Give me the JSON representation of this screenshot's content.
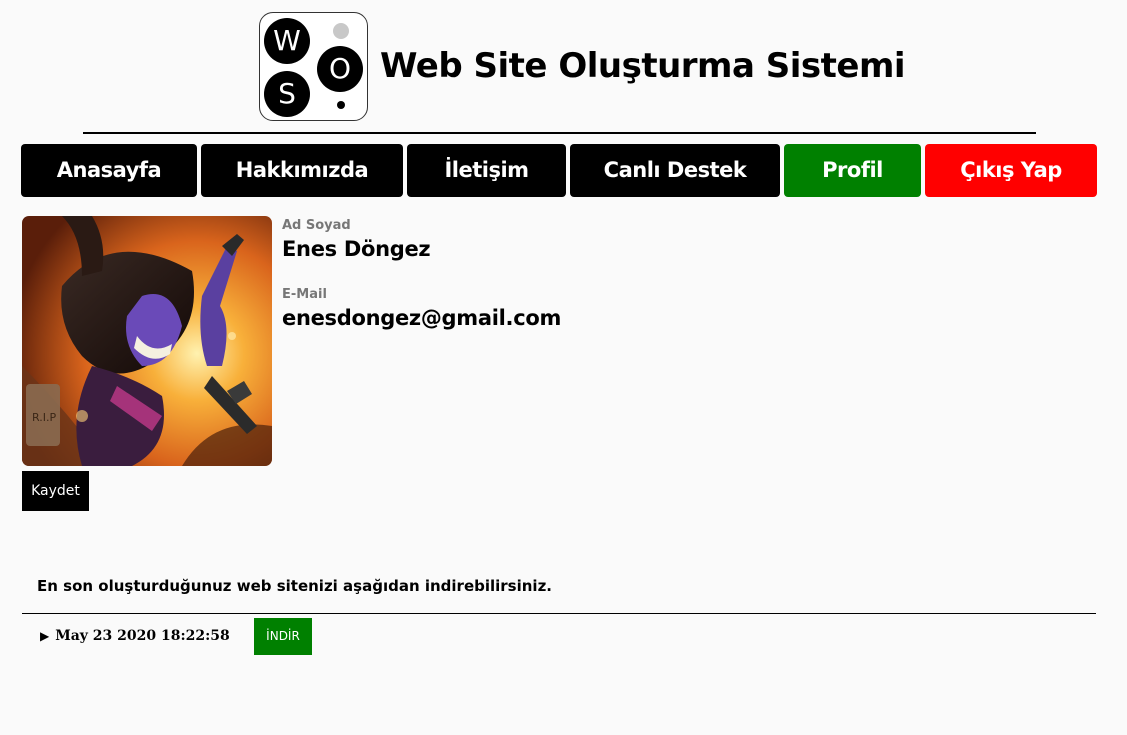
{
  "header": {
    "logo": {
      "letters": [
        "W",
        "S",
        "O"
      ]
    },
    "title": "Web Site Oluşturma Sistemi"
  },
  "nav": {
    "items": [
      {
        "label": "Anasayfa",
        "style": "dark"
      },
      {
        "label": "Hakkımızda",
        "style": "dark"
      },
      {
        "label": "İletişim",
        "style": "dark"
      },
      {
        "label": "Canlı Destek",
        "style": "dark"
      },
      {
        "label": "Profil",
        "style": "green"
      },
      {
        "label": "Çıkış Yap",
        "style": "red"
      }
    ]
  },
  "profile": {
    "name_label": "Ad Soyad",
    "name_value": "Enes Döngez",
    "email_label": "E-Mail",
    "email_value": "enesdongez@gmail.com",
    "save_label": "Kaydet"
  },
  "downloads": {
    "info_text": "En son oluşturduğunuz web sitenizi aşağıdan indirebilirsiniz.",
    "entries": [
      {
        "date": "May 23 2020 18:22:58",
        "button_label": "İNDİR"
      }
    ]
  },
  "colors": {
    "nav_dark": "#000000",
    "nav_active": "#008000",
    "nav_logout": "#ff0000",
    "download_button": "#008000"
  }
}
